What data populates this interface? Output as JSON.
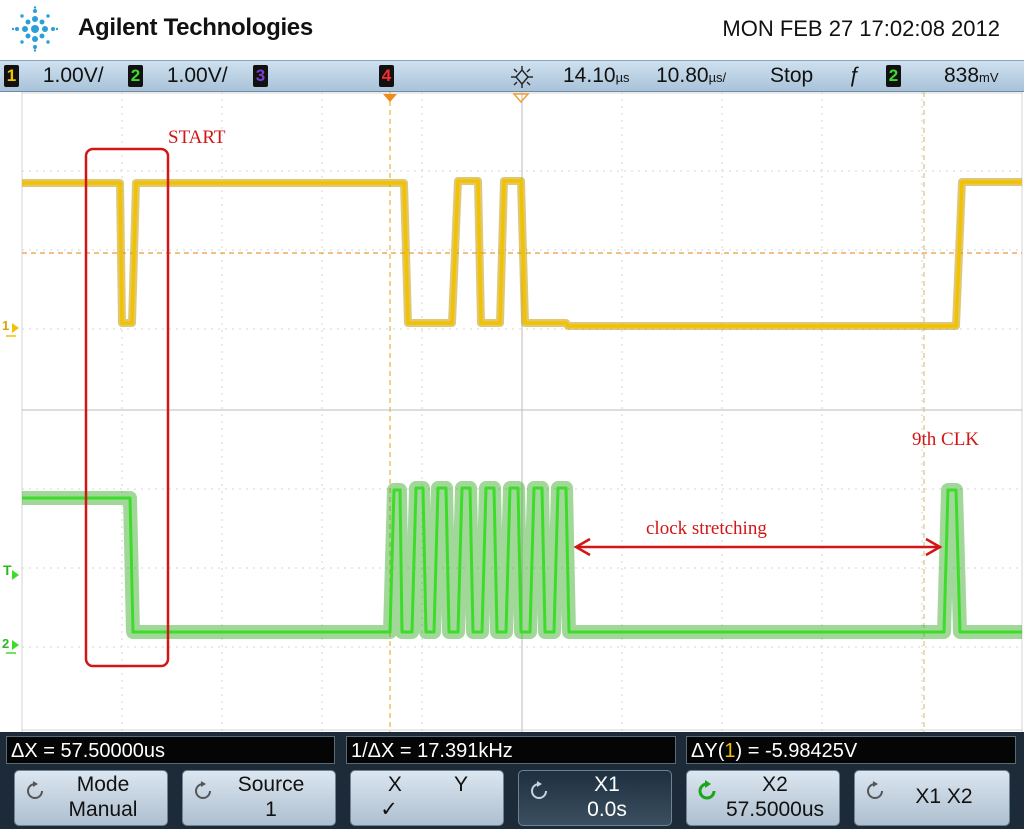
{
  "header": {
    "brand": "Agilent Technologies",
    "datetime": "MON FEB 27 17:02:08 2012",
    "logo_icon": "agilent-spark-icon"
  },
  "statusbar": {
    "ch1_num": "1",
    "ch1_scale": "1.00V/",
    "ch2_num": "2",
    "ch2_scale": "1.00V/",
    "ch3_num": "3",
    "ch4_num": "4",
    "delay": "14.10",
    "delay_unit": "µs",
    "timebase": "10.80",
    "timebase_unit": "µs/",
    "run_state": "Stop",
    "trig_slope_symbol": "ƒ",
    "trig_source": "2",
    "trig_level": "838",
    "trig_level_unit": "mV",
    "colors": {
      "ch1": "#f2c200",
      "ch2": "#3ddc2a",
      "ch3": "#7b3fd0",
      "ch4": "#ff2b2b"
    }
  },
  "screen": {
    "ch1_marker": "1",
    "ch2_marker": "2",
    "trig_marker": "T",
    "annotations": {
      "start": "START",
      "ninth_clk": "9th CLK",
      "clock_stretching": "clock stretching"
    },
    "trace_colors": {
      "ch1": "#e8b410",
      "ch2": "#3ed21e",
      "annotation": "#d21515"
    }
  },
  "measurements": {
    "delta_x": "ΔX = 57.50000us",
    "inv_delta_x": "1/ΔX = 17.391kHz",
    "delta_y_prefix": "ΔY(",
    "delta_y_ch": "1",
    "delta_y_suffix": ") = -5.98425V"
  },
  "softkeys": [
    {
      "l1": "Mode",
      "l2": "Manual"
    },
    {
      "l1": "Source",
      "l2": "1"
    },
    {
      "l1": "X         Y",
      "l2": "✓"
    },
    {
      "l1": "X1",
      "l2": "0.0s"
    },
    {
      "l1": "X2",
      "l2": "57.5000us"
    },
    {
      "l1": "X1  X2",
      "l2": ""
    }
  ]
}
